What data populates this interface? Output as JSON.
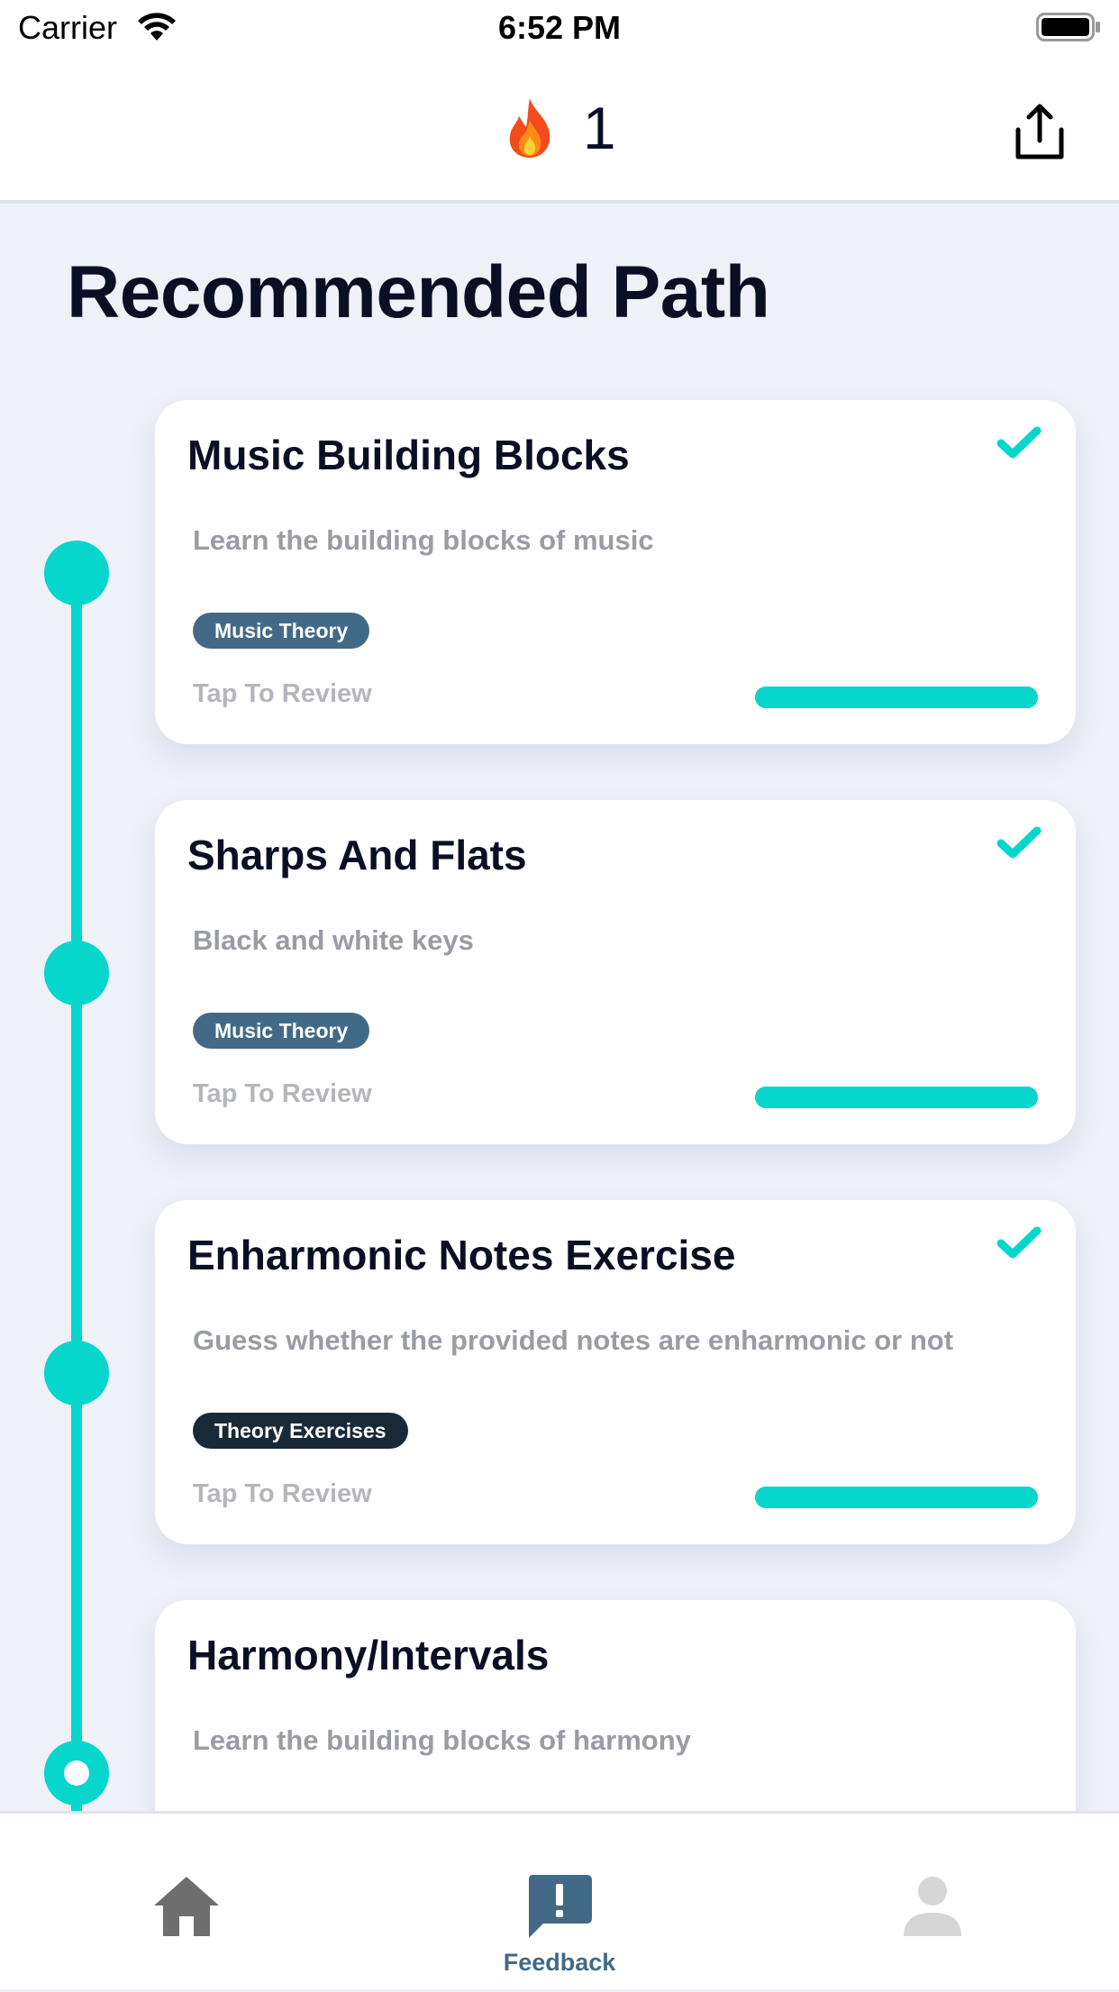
{
  "status_bar": {
    "carrier": "Carrier",
    "time": "6:52 PM"
  },
  "header": {
    "streak_icon": "flame-icon",
    "streak_count": "1",
    "share_icon": "share-icon"
  },
  "page": {
    "title": "Recommended Path"
  },
  "accent_color": "#06d6cc",
  "cards": [
    {
      "title": "Music Building Blocks",
      "description": "Learn the building blocks of music",
      "tag": "Music Theory",
      "action": "Tap To Review",
      "completed": true,
      "progress": 1.0
    },
    {
      "title": "Sharps And Flats",
      "description": "Black and white keys",
      "tag": "Music Theory",
      "action": "Tap To Review",
      "completed": true,
      "progress": 1.0
    },
    {
      "title": "Enharmonic Notes Exercise",
      "description": "Guess whether the provided notes are enharmonic or not",
      "tag": "Theory Exercises",
      "action": "Tap To Review",
      "completed": true,
      "progress": 1.0
    },
    {
      "title": "Harmony/Intervals",
      "description": "Learn the building blocks of harmony"
    }
  ],
  "tab_bar": {
    "items": [
      {
        "icon": "home-icon",
        "label": "",
        "active": false
      },
      {
        "icon": "feedback-icon",
        "label": "Feedback",
        "active": true
      },
      {
        "icon": "profile-icon",
        "label": "",
        "active": false
      }
    ]
  }
}
